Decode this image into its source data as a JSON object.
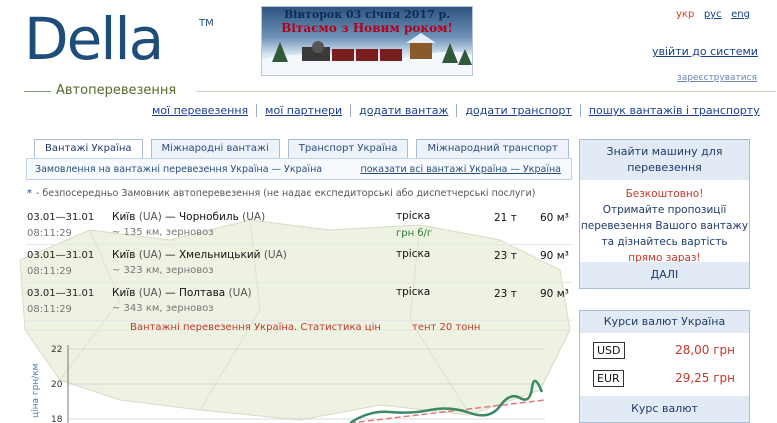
{
  "brand": {
    "logo_text": "Della",
    "tm": "TM",
    "subtitle": "Автоперевезення"
  },
  "banner": {
    "date": "Вівторок 03 січня 2017 р.",
    "greeting": "Вітаємо з Новим роком!"
  },
  "languages": {
    "current": "укр",
    "options": [
      "рус",
      "eng"
    ]
  },
  "auth": {
    "login": "увійти до системи",
    "register": "зареєструватися"
  },
  "nav": [
    "мої перевезення",
    "мої партнери",
    "додати вантаж",
    "додати транспорт",
    "пошук вантажів і транспорту"
  ],
  "tabs": [
    "Вантажі Україна",
    "Міжнародні вантажі",
    "Транспорт Україна",
    "Міжнародний транспорт"
  ],
  "tab_panel": {
    "description": "Замовлення на вантажні перевезення Україна — Україна",
    "show_all": "показати всі вантажі Україна — Україна"
  },
  "note": {
    "star": "*",
    "text": "- безпосередньо Замовник автоперевезення (не надає експедиторські або диспетчерські послуги)"
  },
  "listings": [
    {
      "dates": "03.01—31.01",
      "time": "08:11:29",
      "from": "Київ",
      "from_cc": "(UA)",
      "to": "Чорнобиль",
      "to_cc": "(UA)",
      "distance": "~ 135 км, зерновоз",
      "truck": "тріска",
      "payment": "грн б/г",
      "weight": "21 т",
      "volume": "60 м³"
    },
    {
      "dates": "03.01—31.01",
      "time": "08:11:29",
      "from": "Київ",
      "from_cc": "(UA)",
      "to": "Хмельницький",
      "to_cc": "(UA)",
      "distance": "~ 323 км, зерновоз",
      "truck": "тріска",
      "payment": "",
      "weight": "23 т",
      "volume": "90 м³"
    },
    {
      "dates": "03.01—31.01",
      "time": "08:11:29",
      "from": "Київ",
      "from_cc": "(UA)",
      "to": "Полтава",
      "to_cc": "(UA)",
      "distance": "~ 343 км, зерновоз",
      "truck": "тріска",
      "payment": "",
      "weight": "23 т",
      "volume": "90 м³"
    }
  ],
  "stats": {
    "title": "Вантажні перевезення Україна. Статистика цін",
    "subtitle": "тент 20 тонн",
    "ylabel": "ціна грн/км",
    "yticks": [
      "22",
      "20",
      "18"
    ]
  },
  "sidebar": {
    "find_car": {
      "title": "Знайти машину для перевезення",
      "free": "Безкоштовно!",
      "text": "Отримайте пропозиції перевезення Вашого вантажу та дізнайтесь вартість",
      "now": "прямо зараз!",
      "next": "ДАЛІ"
    },
    "rates": {
      "title": "Курси валют Україна",
      "items": [
        {
          "code": "USD",
          "value": "28,00 грн"
        },
        {
          "code": "EUR",
          "value": "29,25 грн"
        }
      ],
      "footer": "Курс валют"
    }
  },
  "colors": {
    "brand": "#1f4d7a",
    "link": "#1a3f8c",
    "accent_red": "#c0392b",
    "panel": "#e2ebf5"
  }
}
